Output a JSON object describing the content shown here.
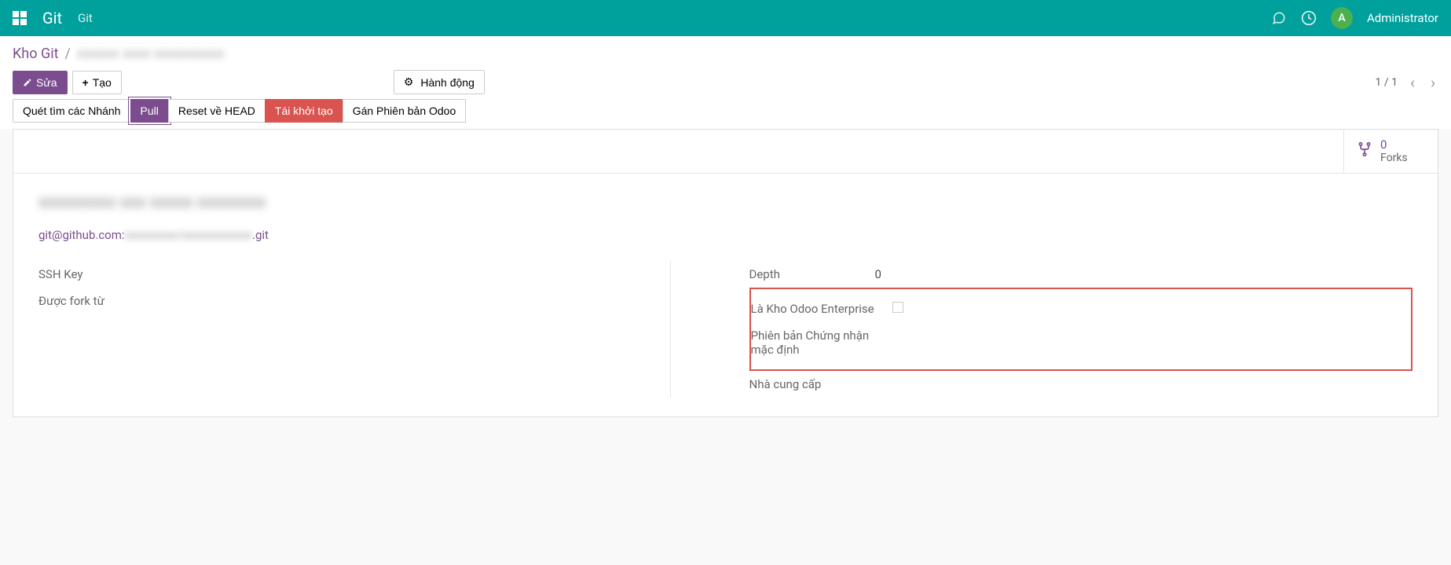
{
  "navbar": {
    "app_title": "Git",
    "breadcrumb": "Git",
    "user_initial": "A",
    "user_name": "Administrator"
  },
  "breadcrumb": {
    "parent": "Kho Git",
    "current": "xxxxxx xxxx xxxxxxxxxx"
  },
  "buttons": {
    "edit": "Sửa",
    "create": "Tạo",
    "action": "Hành động"
  },
  "pager": {
    "text": "1 / 1"
  },
  "actions": {
    "scan_branches": "Quét tìm các Nhánh",
    "pull": "Pull",
    "reset_head": "Reset về HEAD",
    "reinit": "Tái khởi tạo",
    "assign_odoo": "Gán Phiên bản Odoo"
  },
  "stat": {
    "forks_count": "0",
    "forks_label": "Forks"
  },
  "record": {
    "title": "xxxxxxxxx xxx xxxxx xxxxxxxx",
    "url_prefix": "git@github.com:",
    "url_blurred": "xxxxxxxxx/xxxxxxxxxxxx",
    "url_suffix": ".git"
  },
  "fields": {
    "ssh_key_label": "SSH Key",
    "ssh_key_value": "",
    "forked_from_label": "Được fork từ",
    "forked_from_value": "",
    "depth_label": "Depth",
    "depth_value": "0",
    "is_enterprise_label": "Là Kho Odoo Enterprise",
    "default_cert_label": "Phiên bản Chứng nhận mặc định",
    "default_cert_value": "",
    "vendor_label": "Nhà cung cấp",
    "vendor_value": ""
  }
}
